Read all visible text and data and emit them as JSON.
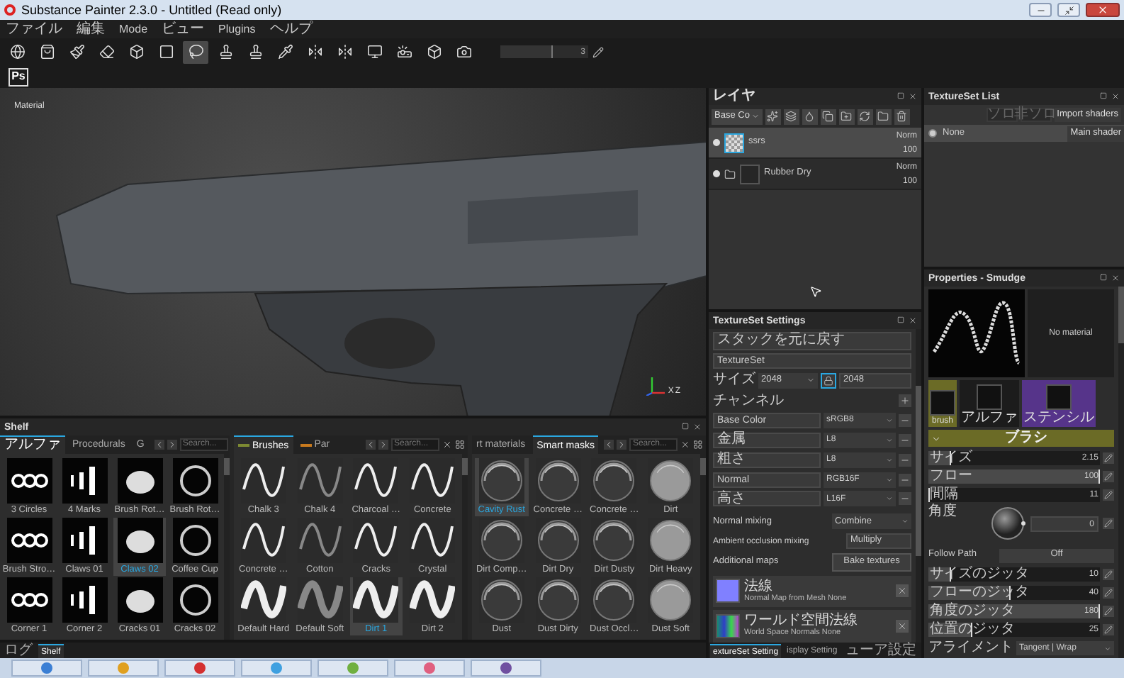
{
  "window": {
    "title": "Substance Painter 2.3.0 - Untitled (Read only)"
  },
  "menu": [
    "ファイル",
    "編集",
    "Mode",
    "ビュー",
    "Plugins",
    "ヘルプ"
  ],
  "toolbar": {
    "tools": [
      {
        "kind": "sphere",
        "selected": false
      },
      {
        "kind": "bag",
        "selected": false
      },
      {
        "kind": "brush",
        "selected": false
      },
      {
        "kind": "eraser",
        "selected": false
      },
      {
        "kind": "projection",
        "selected": false
      },
      {
        "kind": "square",
        "selected": false
      },
      {
        "kind": "lasso",
        "selected": true
      },
      {
        "kind": "stamp",
        "selected": false
      },
      {
        "kind": "stamp",
        "selected": false
      },
      {
        "kind": "pipette",
        "selected": false
      },
      {
        "kind": "mirror",
        "selected": false
      },
      {
        "kind": "mirror",
        "selected": false
      },
      {
        "kind": "monitor",
        "selected": false
      },
      {
        "kind": "projector",
        "selected": false
      },
      {
        "kind": "cube",
        "selected": false
      },
      {
        "kind": "camera",
        "selected": false
      }
    ],
    "value": "3",
    "level": 0.6
  },
  "photoshop_button": "Ps",
  "viewport": {
    "label": "Material",
    "axes": [
      "X",
      "Z"
    ]
  },
  "shelf": {
    "title": "Shelf",
    "panels": [
      {
        "kind": "alpha",
        "tabs": [
          {
            "label": "アルファ",
            "selected": true
          },
          {
            "label": "Procedurals",
            "selected": false
          },
          {
            "label": "G",
            "selected": false
          }
        ],
        "search": {
          "placeholder": "Search..."
        },
        "items": [
          {
            "label": "3 Circles",
            "selected": false
          },
          {
            "label": "4 Marks",
            "selected": false
          },
          {
            "label": "Brush Rot…",
            "selected": false
          },
          {
            "label": "Brush Rot…",
            "selected": false
          },
          {
            "label": "Brush Stro…",
            "selected": false
          },
          {
            "label": "Claws 01",
            "selected": false
          },
          {
            "label": "Claws 02",
            "selected": true
          },
          {
            "label": "Coffee Cup",
            "selected": false
          },
          {
            "label": "Corner 1",
            "selected": false
          },
          {
            "label": "Corner 2",
            "selected": false
          },
          {
            "label": "Cracks 01",
            "selected": false
          },
          {
            "label": "Cracks 02",
            "selected": false
          }
        ]
      },
      {
        "kind": "brush",
        "tabs": [
          {
            "label": "Brushes",
            "selected": true,
            "color": "#7d8a32"
          },
          {
            "label": "Par",
            "selected": false,
            "color": "#c87a1e"
          }
        ],
        "search": {
          "placeholder": "Search..."
        },
        "items": [
          {
            "label": "Chalk 3",
            "selected": false
          },
          {
            "label": "Chalk 4",
            "selected": false
          },
          {
            "label": "Charcoal …",
            "selected": false
          },
          {
            "label": "Concrete",
            "selected": false
          },
          {
            "label": "Concrete …",
            "selected": false
          },
          {
            "label": "Cotton",
            "selected": false
          },
          {
            "label": "Cracks",
            "selected": false
          },
          {
            "label": "Crystal",
            "selected": false
          },
          {
            "label": "Default Hard",
            "selected": false
          },
          {
            "label": "Default Soft",
            "selected": false
          },
          {
            "label": "Dirt 1",
            "selected": true
          },
          {
            "label": "Dirt 2",
            "selected": false
          }
        ]
      },
      {
        "kind": "mask",
        "tabs": [
          {
            "label": "rt materials",
            "selected": false
          },
          {
            "label": "Smart masks",
            "selected": true
          }
        ],
        "search": {
          "placeholder": "Search..."
        },
        "items": [
          {
            "label": "Cavity Rust",
            "selected": true
          },
          {
            "label": "Concrete …",
            "selected": false
          },
          {
            "label": "Concrete …",
            "selected": false
          },
          {
            "label": "Dirt",
            "selected": false
          },
          {
            "label": "Dirt Comp…",
            "selected": false
          },
          {
            "label": "Dirt Dry",
            "selected": false
          },
          {
            "label": "Dirt Dusty",
            "selected": false
          },
          {
            "label": "Dirt Heavy",
            "selected": false
          },
          {
            "label": "Dust",
            "selected": false
          },
          {
            "label": "Dust Dirty",
            "selected": false
          },
          {
            "label": "Dust Occl…",
            "selected": false
          },
          {
            "label": "Dust Soft",
            "selected": false
          }
        ]
      }
    ]
  },
  "bottom_tabs": [
    {
      "label": "ログ",
      "selected": false
    },
    {
      "label": "Shelf",
      "selected": true
    }
  ],
  "layers": {
    "title": "レイヤ",
    "channel": "Base Co",
    "rows": [
      {
        "kind": "paint",
        "name": "ssrs",
        "blend": "Norm",
        "opacity": "100",
        "selected": true,
        "visible": true
      },
      {
        "kind": "folder",
        "name": "Rubber Dry",
        "blend": "Norm",
        "opacity": "100",
        "selected": false,
        "visible": true
      }
    ]
  },
  "texture_set_list": {
    "title": "TextureSet List",
    "buttons": [
      "ソロ",
      "非ソロ"
    ],
    "import_button": "Import shaders",
    "rows": [
      {
        "name": "None",
        "shader": "Main shader",
        "selected": true
      }
    ]
  },
  "texture_set_settings": {
    "title": "TextureSet Settings",
    "revert_button": "スタックを元に戻す",
    "name": "TextureSet",
    "size_label": "サイズ",
    "size": "2048",
    "size_2": "2048",
    "channels_label": "チャンネル",
    "channels": [
      {
        "name": "Base Color",
        "format": "sRGB8"
      },
      {
        "name": "金属",
        "format": "L8"
      },
      {
        "name": "粗さ",
        "format": "L8"
      },
      {
        "name": "Normal",
        "format": "RGB16F"
      },
      {
        "name": "高さ",
        "format": "L16F"
      }
    ],
    "normal_mixing": {
      "label": "Normal mixing",
      "value": "Combine"
    },
    "ao_mixing": {
      "label": "Ambient occlusion mixing",
      "value": "Multiply"
    },
    "additional_maps": {
      "label": "Additional maps",
      "button": "Bake textures"
    },
    "maps": [
      {
        "kind": "normal",
        "name": "法線",
        "detail": "Normal Map from Mesh None"
      },
      {
        "kind": "world",
        "name": "ワールド空間法線",
        "detail": "World Space Normals None"
      }
    ],
    "tabs": [
      {
        "label": "extureSet Setting",
        "selected": true
      },
      {
        "label": "isplay Setting",
        "selected": false
      },
      {
        "label": "ューア設定",
        "selected": false
      }
    ]
  },
  "properties": {
    "title": "Properties - Smudge",
    "material": "No material",
    "slots": [
      {
        "label": "brush",
        "color": "#6b6b26"
      },
      {
        "label": "アルファ",
        "color": "#1c1c1c"
      },
      {
        "label": "ステンシル",
        "color": "#56348a"
      }
    ],
    "section": {
      "title": "ブラシ",
      "expanded": true
    },
    "sliders": [
      {
        "label": "サイズ",
        "value": "2.15",
        "level": 0.13
      },
      {
        "label": "フロー",
        "value": "100",
        "level": 1
      },
      {
        "label": "間隔",
        "value": "11",
        "level": 0.01
      }
    ],
    "angle": {
      "label": "角度",
      "value": "0"
    },
    "follow_path": {
      "label": "Follow Path",
      "value": "Off"
    },
    "jitters": [
      {
        "label": "サイズのジッタ",
        "value": "10",
        "level": 0.13
      },
      {
        "label": "フローのジッタ",
        "value": "40",
        "level": 0.48
      },
      {
        "label": "角度のジッタ",
        "value": "180",
        "level": 1
      },
      {
        "label": "位置のジッタ",
        "value": "25",
        "level": 0.26
      }
    ],
    "alignment": {
      "label": "アライメント",
      "value": "Tangent | Wrap"
    }
  }
}
